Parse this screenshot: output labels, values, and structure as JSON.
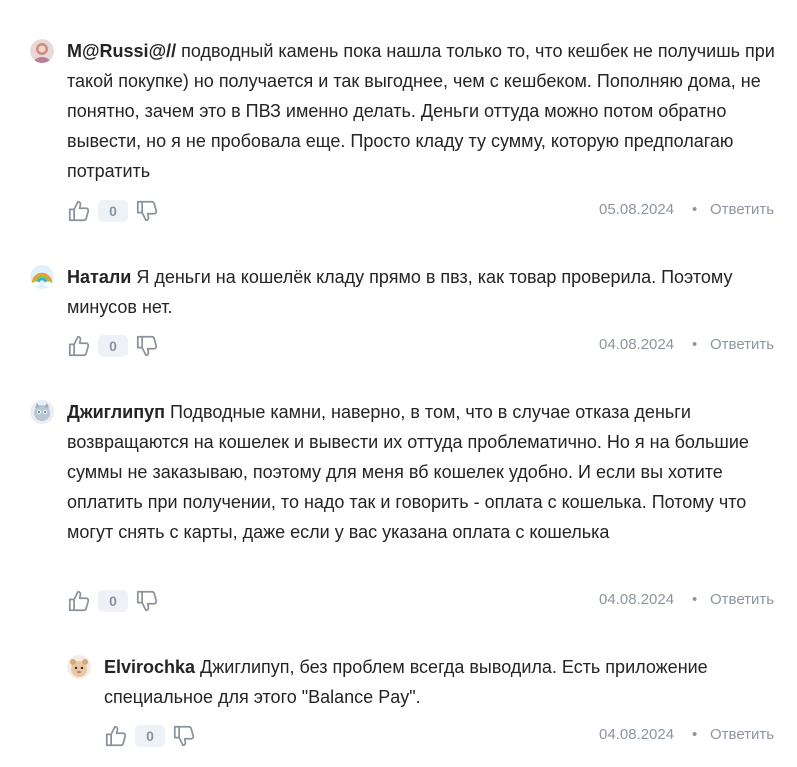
{
  "comments": [
    {
      "author": "M@Russi@//",
      "text": " подводный камень пока нашла только то, что кешбек не получишь при такой покупке) но получается и так выгоднее, чем с кешбеком. Пополняю дома, не понятно, зачем это в ПВЗ именно делать. Деньги оттуда можно потом обратно вывести, но я не пробовала еще. Просто кладу ту сумму, которую предполагаю потратить",
      "likes": "0",
      "date": "05.08.2024",
      "reply_label": "Ответить"
    },
    {
      "author": "Натали",
      "text": " Я деньги на кошелёк кладу прямо в пвз, как товар проверила. Поэтому минусов нет.",
      "likes": "0",
      "date": "04.08.2024",
      "reply_label": "Ответить"
    },
    {
      "author": "Джиглипуп",
      "text": " Подводные камни, наверно, в том, что в случае отказа деньги возвращаются на кошелек и вывести их оттуда проблематично. Но я на большие суммы не заказываю, поэтому для меня вб кошелек удобно. И если вы хотите оплатить при получении, то надо так и говорить - оплата с кошелька. Потому что могут снять с карты, даже если у вас указана оплата с кошелька",
      "likes": "0",
      "date": "04.08.2024",
      "reply_label": "Ответить"
    },
    {
      "author": "Elvirochka",
      "text": " Джиглипуп, без проблем всегда выводила. Есть приложение специальное для этого \"Balance Pay\".",
      "likes": "0",
      "date": "04.08.2024",
      "reply_label": "Ответить"
    }
  ],
  "separator": "•",
  "colors": {
    "meta_text": "#8d96a0",
    "count_bg": "#eef1f5",
    "body_text": "#242424"
  }
}
